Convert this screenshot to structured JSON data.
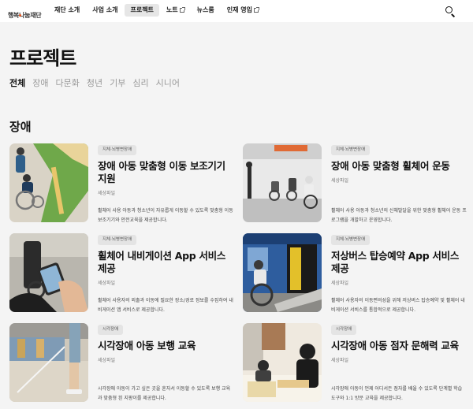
{
  "header": {
    "logo": "행복나눔재단",
    "nav": [
      {
        "label": "재단 소개",
        "active": false,
        "external": false
      },
      {
        "label": "사업 소개",
        "active": false,
        "external": false
      },
      {
        "label": "프로젝트",
        "active": true,
        "external": false
      },
      {
        "label": "노트",
        "active": false,
        "external": true
      },
      {
        "label": "뉴스룸",
        "active": false,
        "external": false
      },
      {
        "label": "인재 영입",
        "active": false,
        "external": true
      }
    ],
    "search_icon": "search-icon"
  },
  "page": {
    "title": "프로젝트",
    "filters": [
      "전체",
      "장애",
      "다문화",
      "청년",
      "기부",
      "심리",
      "시니어"
    ],
    "active_filter": "전체"
  },
  "section": {
    "title": "장애"
  },
  "cards": [
    {
      "tag": "지체·뇌병변장애",
      "title": "장애 아동 맞춤형 이동 보조기기 지원",
      "org": "세상파일",
      "desc": "휠체어 사용 아동과 청소년이 자유롭게 이동할 수 있도록 맞춤형 이동보조기기와 안전교육을 제공합니다."
    },
    {
      "tag": "지체·뇌병변장애",
      "title": "장애 아동 맞춤형 휠체어 운동",
      "org": "세상파일",
      "desc": "휠체어 사용 아동과 청소년의 신체발달을 위한 맞춤형 휠체어 운동 프로그램을 개발하고 운영합니다."
    },
    {
      "tag": "지체·뇌병변장애",
      "title": "휠체어 내비게이션 App 서비스 제공",
      "org": "세상파일",
      "desc": "휠체어 사용자의 외출과 이동에 필요한 장소/경로 정보를 수집하여 내비게이션 앱 서비스로 제공합니다."
    },
    {
      "tag": "지체·뇌병변장애",
      "title": "저상버스 탑승예약 App 서비스 제공",
      "org": "세상파일",
      "desc": "휠체어 사용자의 이동편의성을 위해 저상버스 탑승예약 및 휠체어 내비게이션 서비스를 통합적으로 제공합니다."
    },
    {
      "tag": "시각장애",
      "title": "시각장애 아동 보행 교육",
      "org": "세상파일",
      "desc": "시각장애 아동이 가고 싶은 곳을 혼자서 이동할 수 있도록 보행 교육과 맞춤형 흰 지팡이를 제공합니다."
    },
    {
      "tag": "시각장애",
      "title": "시각장애 아동 점자 문해력 교육",
      "org": "세상파일",
      "desc": "시각장애 아동이 언제 어디서든 점자를 배울 수 있도록 단계별 학습 도구와 1:1 방문 교육을 제공합니다."
    }
  ]
}
